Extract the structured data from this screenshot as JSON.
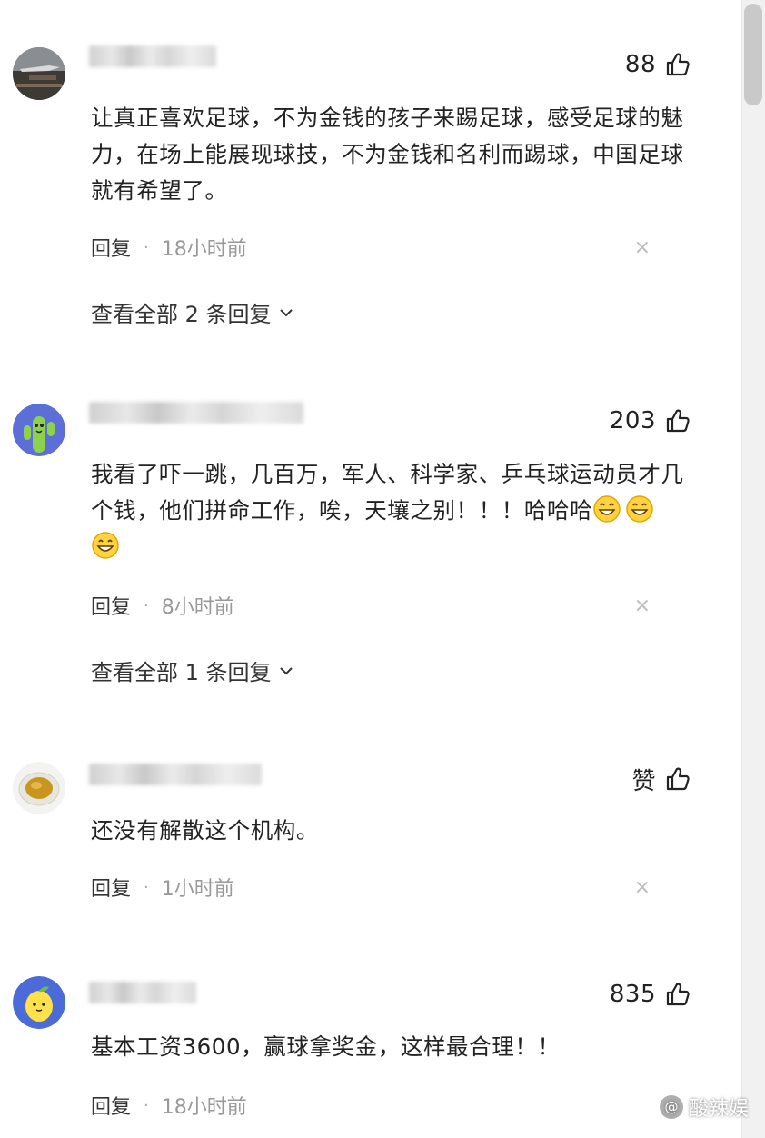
{
  "colors": {
    "text_primary": "#222222",
    "text_secondary": "#999999",
    "scrollbar": "#c9c9c9"
  },
  "comments": [
    {
      "likes": "88",
      "text": "让真正喜欢足球，不为金钱的孩子来踢足球，感受足球的魅力，在场上能展现球技，不为金钱和名利而踢球，中国足球就有希望了。",
      "reply_label": "回复",
      "separator": "·",
      "time": "18小时前",
      "close": "×",
      "view_replies": "查看全部 2 条回复",
      "avatar_icon": "avatar-airplane-photo"
    },
    {
      "likes": "203",
      "text": "我看了吓一跳，几百万，军人、科学家、乒乓球运动员才几个钱，他们拼命工作，唉，天壤之别！！！哈哈哈",
      "emoji_icons": [
        "grin-emoji",
        "grin-emoji",
        "grin-emoji"
      ],
      "reply_label": "回复",
      "separator": "·",
      "time": "8小时前",
      "close": "×",
      "view_replies": "查看全部 1 条回复",
      "avatar_icon": "avatar-cactus"
    },
    {
      "likes": "赞",
      "text": "还没有解散这个机构。",
      "reply_label": "回复",
      "separator": "·",
      "time": "1小时前",
      "close": "×",
      "avatar_icon": "avatar-tea-cup"
    },
    {
      "likes": "835",
      "text": "基本工资3600，赢球拿奖金，这样最合理！！",
      "reply_label": "回复",
      "separator": "·",
      "time": "18小时前",
      "avatar_icon": "avatar-lemon"
    }
  ],
  "watermark": {
    "icon": "@",
    "text": "酸辣娱"
  }
}
